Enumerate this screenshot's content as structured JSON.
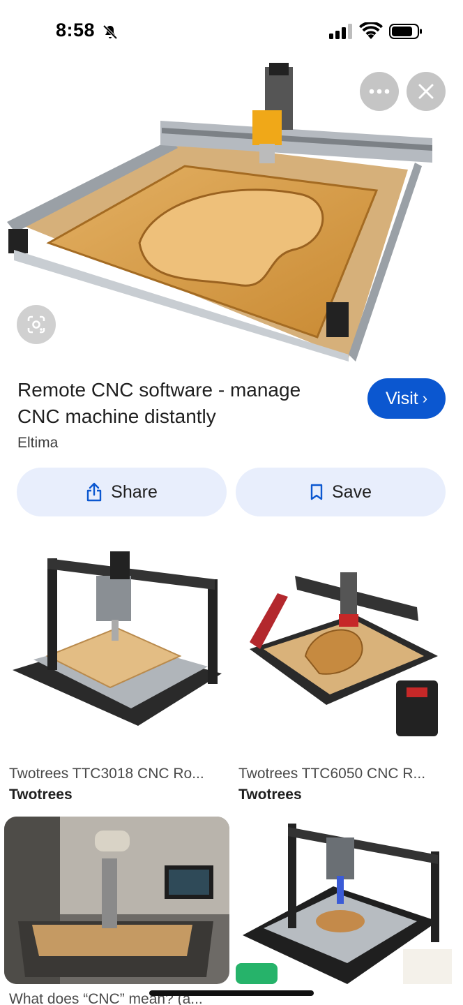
{
  "status": {
    "time": "8:58",
    "icons": [
      "bell-off-icon",
      "signal-icon",
      "wifi-icon",
      "battery-icon"
    ]
  },
  "hero": {
    "buttons": [
      "more-icon",
      "close-icon",
      "lens-icon"
    ]
  },
  "result": {
    "title": "Remote CNC software - manage CNC machine distantly",
    "source": "Eltima",
    "visit_label": "Visit",
    "share_label": "Share",
    "save_label": "Save"
  },
  "related": [
    {
      "title": "Twotrees TTC3018 CNC Ro...",
      "source": "Twotrees"
    },
    {
      "title": "Twotrees TTC6050 CNC R...",
      "source": "Twotrees"
    },
    {
      "title": "What does “CNC” mean? (a...",
      "source": ""
    },
    {
      "title": "",
      "source": ""
    }
  ],
  "colors": {
    "accent": "#0b57d0",
    "pill": "#e8eefc"
  }
}
